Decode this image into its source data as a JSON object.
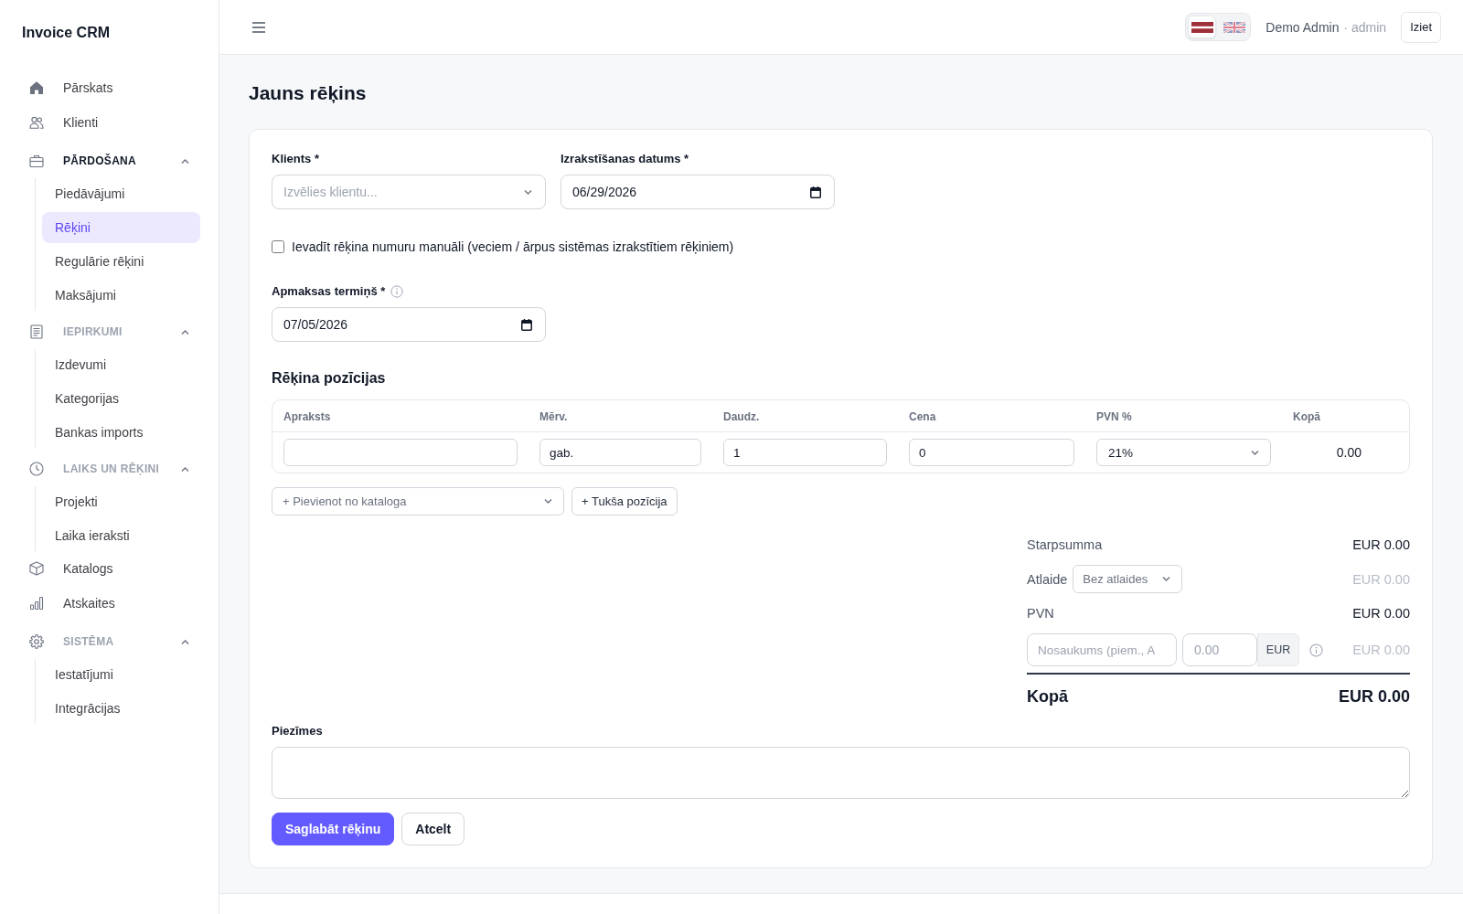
{
  "app": {
    "name": "Invoice CRM"
  },
  "sidebar": {
    "items": [
      {
        "kind": "link",
        "label": "Pārskats",
        "selected": false
      },
      {
        "kind": "link",
        "label": "Klienti",
        "selected": false
      },
      {
        "kind": "section",
        "label": "PĀRDOŠANA",
        "expanded": true,
        "children": [
          {
            "label": "Piedāvājumi",
            "selected": false
          },
          {
            "label": "Rēķini",
            "selected": true
          },
          {
            "label": "Regulārie rēķini",
            "selected": false
          },
          {
            "label": "Maksājumi",
            "selected": false
          }
        ]
      },
      {
        "kind": "section",
        "label": "IEPIRKUMI",
        "expanded": true,
        "children": [
          {
            "label": "Izdevumi",
            "selected": false
          },
          {
            "label": "Kategorijas",
            "selected": false
          },
          {
            "label": "Bankas imports",
            "selected": false
          }
        ]
      },
      {
        "kind": "section",
        "label": "LAIKS UN RĒĶINI",
        "expanded": true,
        "children": [
          {
            "label": "Projekti",
            "selected": false
          },
          {
            "label": "Laika ieraksti",
            "selected": false
          }
        ]
      },
      {
        "kind": "link",
        "label": "Katalogs",
        "selected": false
      },
      {
        "kind": "link",
        "label": "Atskaites",
        "selected": false
      },
      {
        "kind": "section",
        "label": "SISTĒMA",
        "expanded": true,
        "children": [
          {
            "label": "Iestatījumi",
            "selected": false
          },
          {
            "label": "Integrācijas",
            "selected": false
          }
        ]
      }
    ]
  },
  "topbar": {
    "languages": [
      {
        "selected": true
      },
      {
        "selected": false
      }
    ],
    "user_name": "Demo Admin",
    "user_role": "· admin",
    "logout_button": "Iziet"
  },
  "page": {
    "title": "Jauns rēķins"
  },
  "form": {
    "client": {
      "label": "Klients *",
      "placeholder": "Izvēlies klientu..."
    },
    "issue_date": {
      "label": "Izrakstīšanas datums *",
      "value": "06/29/2026"
    },
    "manual_number": {
      "label": "Ievadīt rēķina numuru manuāli (veciem / ārpus sistēmas izrakstītiem rēķiniem)",
      "checked": false
    },
    "due_date": {
      "label": "Apmaksas termiņš *",
      "value": "07/05/2026"
    }
  },
  "line_items": {
    "title": "Rēķina pozīcijas",
    "columns": [
      "Apraksts",
      "Mērv.",
      "Daudz.",
      "Cena",
      "PVN %",
      "Kopā"
    ],
    "rows": [
      {
        "unit": "gab.",
        "quantity": "1",
        "price": "0",
        "vat": "21%",
        "total": "0.00"
      }
    ],
    "catalog_select": {
      "placeholder": "+ Pievienot no kataloga"
    },
    "add_empty_button": "+ Tukša pozīcija"
  },
  "totals": {
    "lines": [
      {
        "kind": "plain",
        "label": "Starpsumma",
        "amount": "EUR 0.00",
        "muted": false
      },
      {
        "kind": "discount",
        "label": "Atlaide",
        "select": "Bez atlaides",
        "amount": "EUR 0.00",
        "muted": true
      },
      {
        "kind": "plain",
        "label": "PVN",
        "amount": "EUR 0.00",
        "muted": false
      },
      {
        "kind": "custom",
        "name_placeholder": "Nosaukums (piem., A",
        "value_placeholder": "0.00",
        "unit": "EUR",
        "amount": "EUR 0.00",
        "muted": true
      }
    ],
    "total": {
      "label": "Kopā",
      "amount": "EUR 0.00"
    }
  },
  "notes": {
    "label": "Piezīmes"
  },
  "actions": [
    {
      "kind": "primary",
      "label": "Saglabāt rēķinu"
    },
    {
      "kind": "secondary",
      "label": "Atcelt"
    }
  ]
}
